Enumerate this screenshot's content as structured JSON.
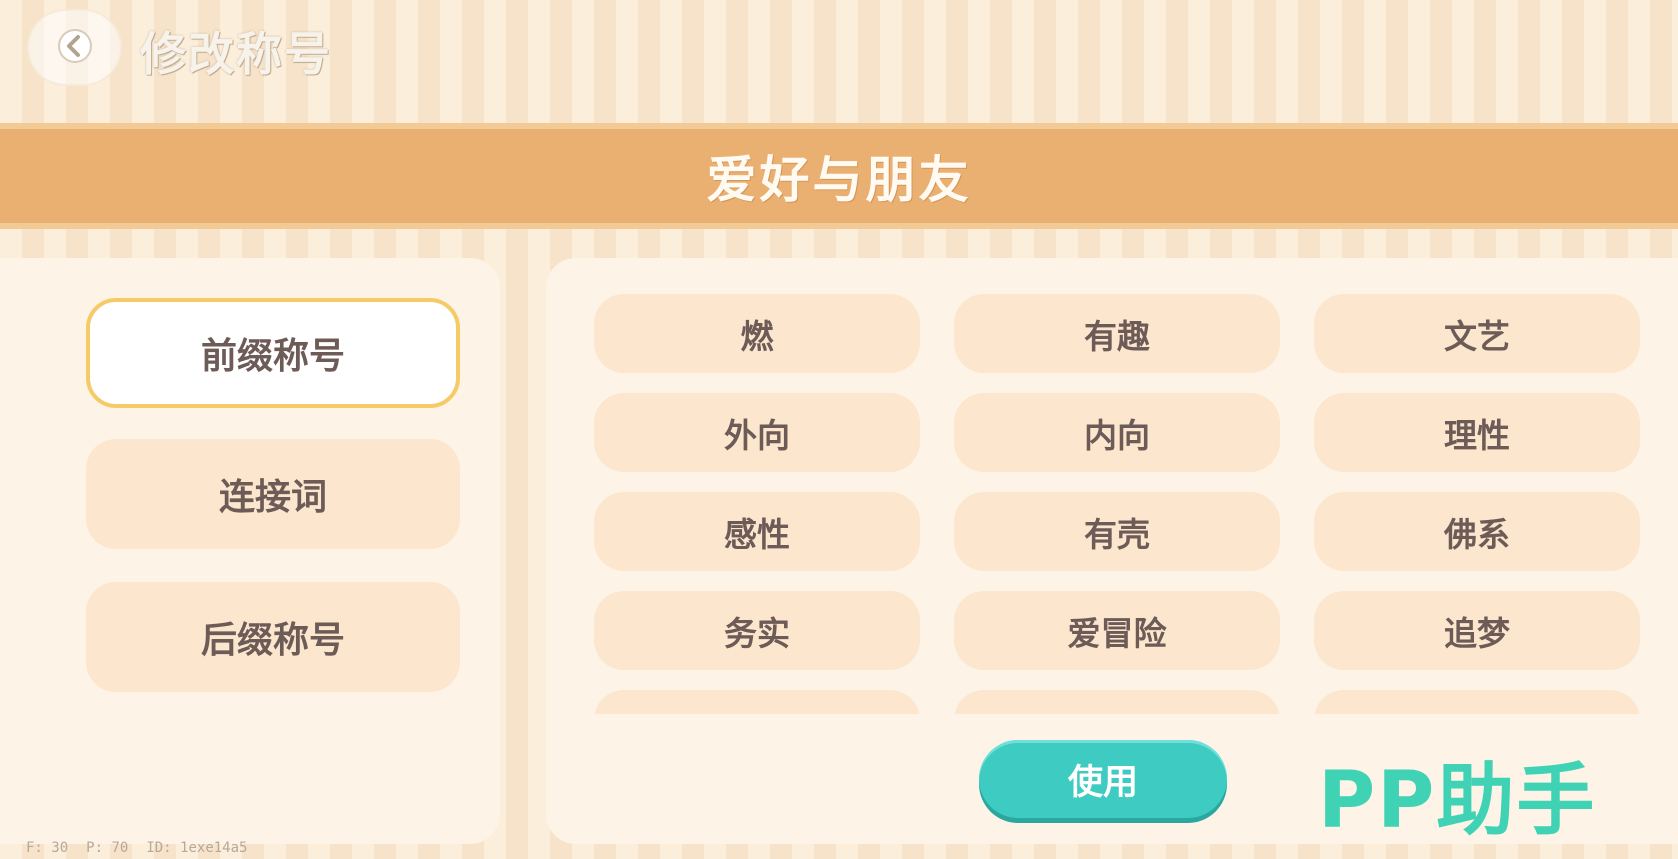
{
  "header": {
    "back_icon": "chevron-left-icon",
    "title": "修改称号"
  },
  "banner": {
    "title": "爱好与朋友"
  },
  "tabs": [
    {
      "label": "前缀称号",
      "active": true
    },
    {
      "label": "连接词",
      "active": false
    },
    {
      "label": "后缀称号",
      "active": false
    }
  ],
  "titles": [
    "燃",
    "有趣",
    "文艺",
    "外向",
    "内向",
    "理性",
    "感性",
    "有壳",
    "佛系",
    "务实",
    "爱冒险",
    "追梦",
    "",
    "",
    ""
  ],
  "actions": {
    "use_label": "使用"
  },
  "watermark": "PP助手",
  "debug": {
    "f": "F: 30",
    "p": "P: 70",
    "id": "ID: 1exe14a5"
  },
  "colors": {
    "banner": "#eab072",
    "tab_bg": "#fce6cd",
    "active_border": "#f5cb68",
    "use_button": "#3ecbc2",
    "text": "#6d5b58"
  }
}
